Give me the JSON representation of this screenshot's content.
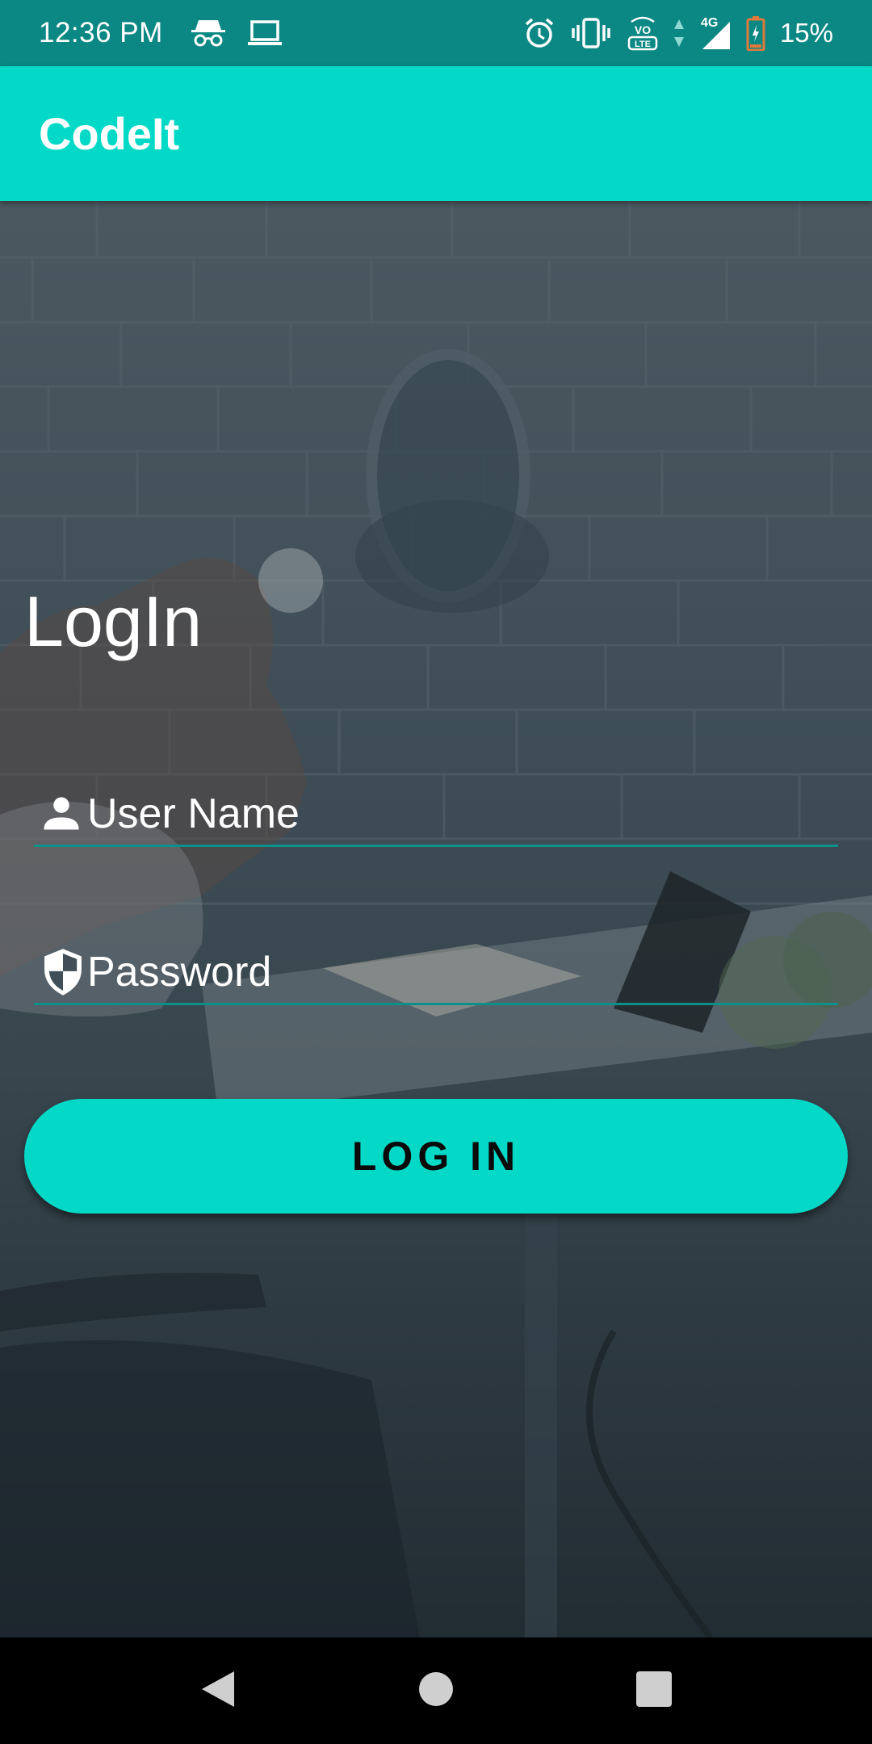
{
  "status_bar": {
    "time": "12:36 PM",
    "battery_percent": "15%",
    "network": "4G",
    "left_icons": [
      "incognito-icon",
      "laptop-icon"
    ],
    "right_icons": [
      "alarm-icon",
      "vibrate-icon",
      "volte-icon",
      "data-arrows-icon",
      "signal-icon",
      "battery-icon"
    ]
  },
  "app_bar": {
    "title": "CodeIt"
  },
  "login": {
    "heading": "LogIn",
    "username": {
      "placeholder": "User Name",
      "value": "",
      "icon": "person-icon"
    },
    "password": {
      "placeholder": "Password",
      "value": "",
      "icon": "shield-icon"
    },
    "button_label": "LOG IN"
  },
  "nav_bar": {
    "buttons": [
      "back-icon",
      "home-icon",
      "recents-icon"
    ]
  },
  "colors": {
    "status_bar": "#0b8784",
    "accent": "#03d9c6",
    "field_underline": "#0d8f8a",
    "nav_bar": "#000000"
  }
}
